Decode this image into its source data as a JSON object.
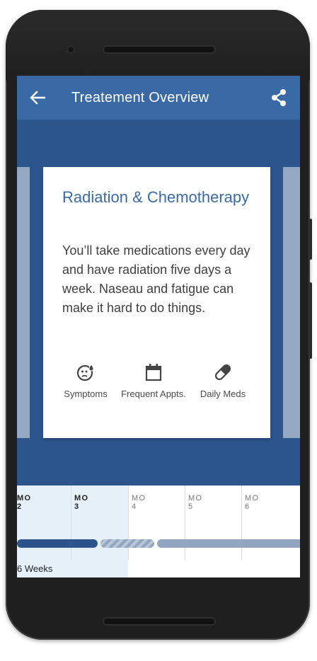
{
  "app": {
    "title": "Treatement Overview"
  },
  "card": {
    "title": "Radiation & Chemotherapy",
    "body": "You’ll take medications every day and have radiation five days a week. Naseau and fatigue can make it hard to do things.",
    "features": [
      {
        "label": "Symptoms",
        "icon": "symptoms-face-icon"
      },
      {
        "label": "Frequent Appts.",
        "icon": "calendar-icon"
      },
      {
        "label": "Daily Meds",
        "icon": "pill-icon"
      }
    ]
  },
  "timeline": {
    "months": [
      "MO 2",
      "MO 3",
      "MO 4",
      "MO 5",
      "MO 6"
    ],
    "active_months": [
      "MO 2",
      "MO 3"
    ],
    "duration_label": "6 Weeks"
  },
  "colors": {
    "appbar": "#3a6aa6",
    "background": "#2c558d",
    "accent_text": "#3a6aa6",
    "timeline_highlight": "#e6f0f8",
    "bar_solid": "#2c558d",
    "bar_light": "#92a6c2"
  }
}
